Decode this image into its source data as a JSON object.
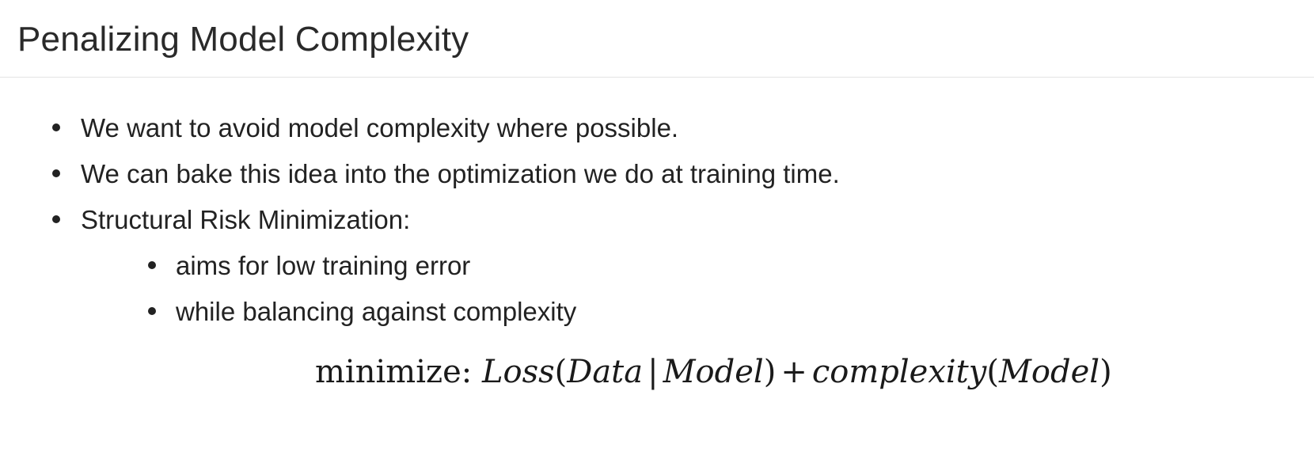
{
  "header": {
    "title": "Penalizing Model Complexity"
  },
  "bullets": [
    {
      "text": "We want to avoid model complexity where possible."
    },
    {
      "text": "We can bake this idea into the optimization we do at training time."
    },
    {
      "text": "Structural Risk Minimization:"
    }
  ],
  "sub_bullets": [
    {
      "text": "aims for low training error"
    },
    {
      "text": "while balancing against complexity"
    }
  ],
  "formula": {
    "keyword": "minimize:",
    "loss": "Loss",
    "open1": "(",
    "data": "Data",
    "bar": "|",
    "model1": "Model",
    "close1": ")",
    "plus": "+",
    "complexity": "complexity",
    "open2": "(",
    "model2": "Model",
    "close2": ")"
  }
}
